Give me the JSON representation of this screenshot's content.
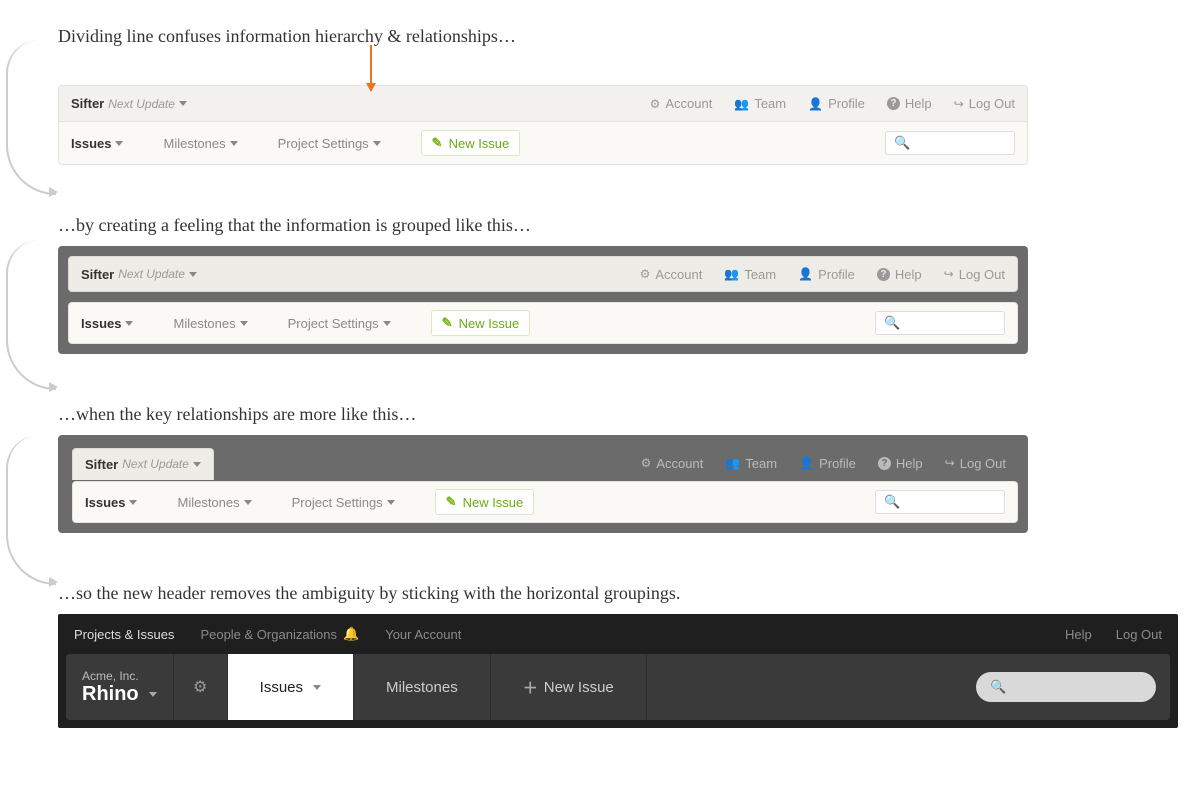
{
  "annotations": {
    "a1": "Dividing line confuses information hierarchy & relationships…",
    "a2": "…by creating a feeling that the information is grouped like this…",
    "a3": "…when the key relationships are more like this…",
    "a4": "…so the new header removes the ambiguity by sticking with the horizontal groupings."
  },
  "sifter": {
    "brand": "Sifter",
    "subtitle": "Next Update",
    "toplinks": {
      "account": "Account",
      "team": "Team",
      "profile": "Profile",
      "help": "Help",
      "logout": "Log Out"
    },
    "nav": {
      "issues": "Issues",
      "milestones": "Milestones",
      "settings": "Project Settings",
      "newissue": "New Issue"
    }
  },
  "newheader": {
    "top": {
      "projects": "Projects & Issues",
      "people": "People & Organizations",
      "account": "Your Account",
      "help": "Help",
      "logout": "Log Out"
    },
    "project": {
      "company": "Acme, Inc.",
      "name": "Rhino"
    },
    "tabs": {
      "issues": "Issues",
      "milestones": "Milestones",
      "newissue": "New Issue"
    }
  },
  "icons": {
    "gear": "⚙",
    "team": "👥",
    "profile": "👤",
    "help": "?",
    "logout": "↪",
    "edit": "✎",
    "search": "🔍",
    "bell": "🔔",
    "plus": "＋"
  }
}
